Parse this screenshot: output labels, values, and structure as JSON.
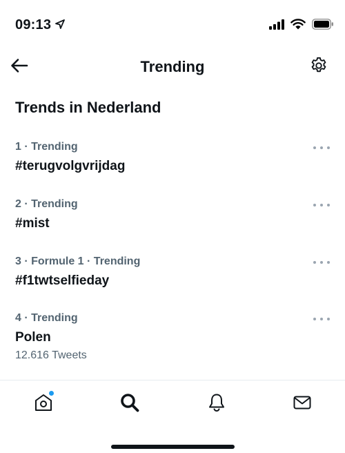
{
  "status_bar": {
    "time": "09:13"
  },
  "header": {
    "title": "Trending"
  },
  "section_title": "Trends in Nederland",
  "trends": [
    {
      "meta": "1 · Trending",
      "name": "#terugvolgvrijdag",
      "count": ""
    },
    {
      "meta": "2 · Trending",
      "name": "#mist",
      "count": ""
    },
    {
      "meta": "3 · Formule 1 · Trending",
      "name": "#f1twtselfieday",
      "count": ""
    },
    {
      "meta": "4 · Trending",
      "name": "Polen",
      "count": "12.616 Tweets"
    }
  ],
  "tabbar": {
    "items": [
      {
        "icon": "home-icon",
        "active": false,
        "badge": true
      },
      {
        "icon": "search-icon",
        "active": true,
        "badge": false
      },
      {
        "icon": "bell-icon",
        "active": false,
        "badge": false
      },
      {
        "icon": "mail-icon",
        "active": false,
        "badge": false
      }
    ]
  },
  "colors": {
    "accent": "#1d9bf0",
    "text": "#0f1419",
    "secondary": "#536471"
  }
}
